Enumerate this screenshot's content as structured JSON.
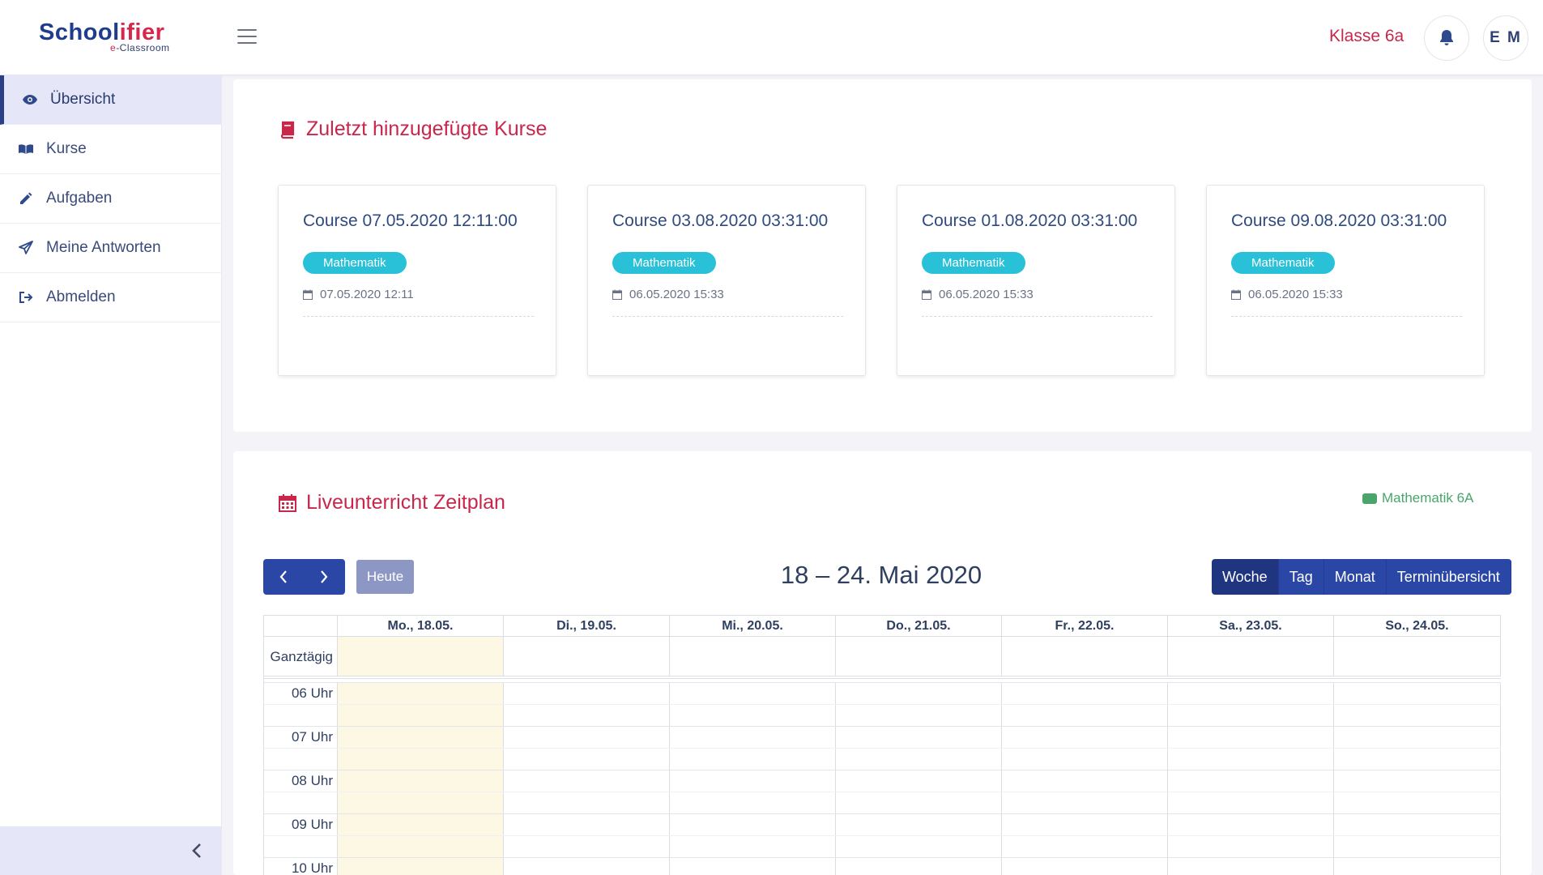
{
  "header": {
    "logo_main_a": "School",
    "logo_main_b": "ifier",
    "logo_sub_e": "e",
    "logo_sub_rest": "-Classroom",
    "klasse": "Klasse 6a",
    "user_initials": "E M"
  },
  "sidebar": {
    "items": [
      {
        "label": "Übersicht",
        "icon": "eye-icon"
      },
      {
        "label": "Kurse",
        "icon": "book-icon"
      },
      {
        "label": "Aufgaben",
        "icon": "pencil-icon"
      },
      {
        "label": "Meine Antworten",
        "icon": "paper-plane-icon"
      },
      {
        "label": "Abmelden",
        "icon": "sign-out-icon"
      }
    ]
  },
  "courses": {
    "title": "Zuletzt hinzugefügte Kurse",
    "cards": [
      {
        "title": "Course 07.05.2020 12:11:00",
        "badge": "Mathematik",
        "date": "07.05.2020 12:11"
      },
      {
        "title": "Course 03.08.2020 03:31:00",
        "badge": "Mathematik",
        "date": "06.05.2020 15:33"
      },
      {
        "title": "Course 01.08.2020 03:31:00",
        "badge": "Mathematik",
        "date": "06.05.2020 15:33"
      },
      {
        "title": "Course 09.08.2020 03:31:00",
        "badge": "Mathematik",
        "date": "06.05.2020 15:33"
      }
    ]
  },
  "calendar": {
    "title": "Liveunterricht Zeitplan",
    "legend": "Mathematik 6A",
    "today_label": "Heute",
    "range": "18 – 24. Mai 2020",
    "views": [
      "Woche",
      "Tag",
      "Monat",
      "Terminübersicht"
    ],
    "active_view": "Woche",
    "days": [
      "Mo., 18.05.",
      "Di., 19.05.",
      "Mi., 20.05.",
      "Do., 21.05.",
      "Fr., 22.05.",
      "Sa., 23.05.",
      "So., 24.05."
    ],
    "allday_label": "Ganztägig",
    "hours": [
      "06 Uhr",
      "07 Uhr",
      "08 Uhr",
      "09 Uhr",
      "10 Uhr"
    ]
  },
  "colors": {
    "brand_blue": "#1f3d8c",
    "brand_red": "#c8274c",
    "badge_cyan": "#28c1d8",
    "button_blue": "#2b47a6",
    "legend_green": "#4aa56b",
    "today_bg": "#fcf8e3"
  }
}
